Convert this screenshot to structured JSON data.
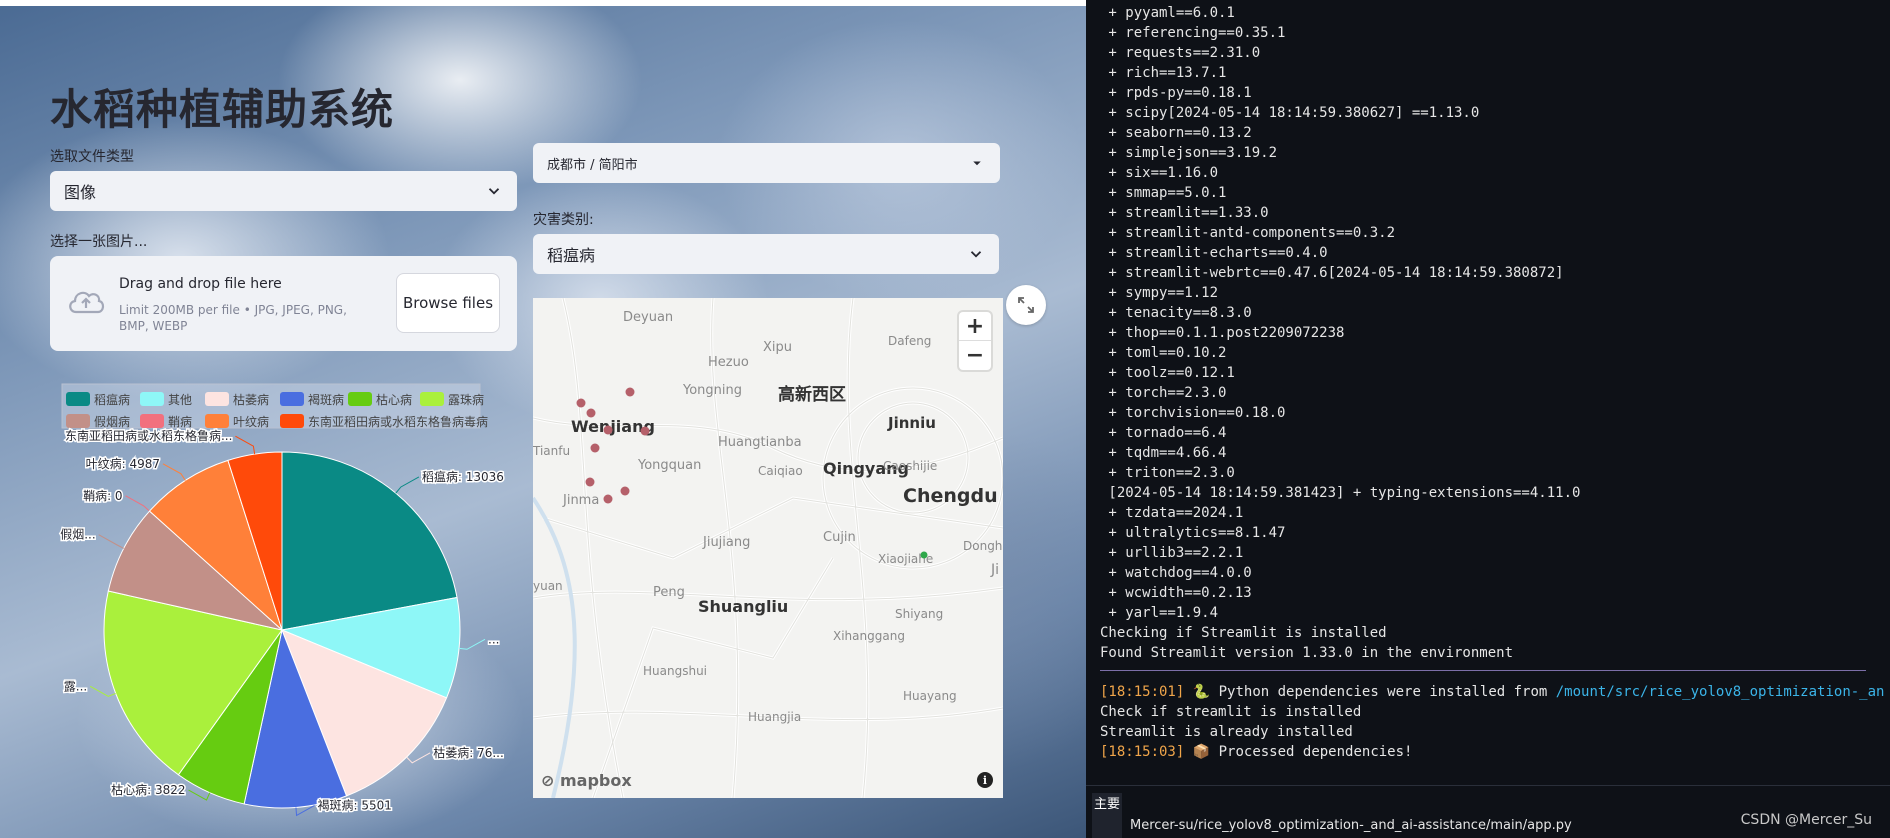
{
  "app": {
    "title": "水稻种植辅助系统",
    "file_type": {
      "label": "选取文件类型",
      "value": "图像"
    },
    "image_picker": {
      "label": "选择一张图片..."
    },
    "uploader": {
      "drag_text": "Drag and drop file here",
      "limit_text": "Limit 200MB per file • JPG, JPEG, PNG, BMP, WEBP",
      "browse_label": "Browse files"
    },
    "location": {
      "value": "成都市 / 简阳市"
    },
    "disaster": {
      "label": "灾害类别:",
      "value": "稻瘟病"
    }
  },
  "chart_data": {
    "type": "pie",
    "title": "",
    "legend": [
      "稻瘟病",
      "其他",
      "枯萎病",
      "褐斑病",
      "枯心病",
      "露珠病",
      "假烟病",
      "鞘病",
      "叶纹病",
      "东南亚稻田病或水稻东格鲁病毒病"
    ],
    "legend_placement": "top-left",
    "slices": [
      {
        "name": "稻瘟病",
        "label": "稻瘟病: 13036",
        "value": 13036,
        "color": "#0a8a85"
      },
      {
        "name": "其他",
        "label": "...",
        "value": 5400,
        "color": "#8ef7f7"
      },
      {
        "name": "枯萎病",
        "label": "枯萎病: 76...",
        "value": 7600,
        "color": "#fde4e1"
      },
      {
        "name": "褐斑病",
        "label": "褐斑病: 5501",
        "value": 5501,
        "color": "#4a6ee0"
      },
      {
        "name": "枯心病",
        "label": "枯心病: 3822",
        "value": 3822,
        "color": "#66cc11"
      },
      {
        "name": "露珠病",
        "label": "露...",
        "value": 11000,
        "color": "#aaf03c"
      },
      {
        "name": "假烟病",
        "label": "假烟...",
        "value": 4800,
        "color": "#c29088"
      },
      {
        "name": "鞘病",
        "label": "鞘病: 0",
        "value": 0,
        "color": "#f2707e"
      },
      {
        "name": "叶纹病",
        "label": "叶纹病: 4987",
        "value": 4987,
        "color": "#ff8039"
      },
      {
        "name": "东南亚稻田病或水稻东格鲁病毒病",
        "label": "东南亚稻田病或水稻东格鲁病...",
        "value": 2900,
        "color": "#ff4a0a"
      }
    ]
  },
  "map": {
    "places": [
      {
        "name": "Deyuan",
        "size": 13
      },
      {
        "name": "Xipu",
        "size": 13
      },
      {
        "name": "Dafeng",
        "size": 12
      },
      {
        "name": "Hezuo",
        "size": 13
      },
      {
        "name": "Yongning",
        "size": 13
      },
      {
        "name": "高新西区",
        "size": 17
      },
      {
        "name": "Jinniu",
        "size": 15
      },
      {
        "name": "Wenjiang",
        "size": 16
      },
      {
        "name": "Tianfu",
        "size": 12
      },
      {
        "name": "Huangtianba",
        "size": 13
      },
      {
        "name": "Qingyang",
        "size": 16
      },
      {
        "name": "Yongquan",
        "size": 13
      },
      {
        "name": "Caiqiao",
        "size": 12
      },
      {
        "name": "Caoshijie",
        "size": 12
      },
      {
        "name": "Chengdu",
        "size": 19
      },
      {
        "name": "Jinma",
        "size": 13
      },
      {
        "name": "Jiujiang",
        "size": 13
      },
      {
        "name": "Cujin",
        "size": 13
      },
      {
        "name": "Xiaojiahe",
        "size": 12
      },
      {
        "name": "Dongh",
        "size": 12
      },
      {
        "name": "Ji",
        "size": 14
      },
      {
        "name": "yuan",
        "size": 12
      },
      {
        "name": "Peng",
        "size": 13
      },
      {
        "name": "Shuangliu",
        "size": 16
      },
      {
        "name": "Shiyang",
        "size": 12
      },
      {
        "name": "Xihanggang",
        "size": 12
      },
      {
        "name": "Huangshui",
        "size": 12
      },
      {
        "name": "Huayang",
        "size": 12
      },
      {
        "name": "Huangjia",
        "size": 12
      }
    ],
    "attribution": "mapbox",
    "zoom_in": "+",
    "zoom_out": "−",
    "info": "i"
  },
  "terminal": {
    "lines": [
      " + pyyaml==6.0.1",
      " + referencing==0.35.1",
      " + requests==2.31.0",
      " + rich==13.7.1",
      " + rpds-py==0.18.1",
      " + scipy[2024-05-14 18:14:59.380627] ==1.13.0",
      " + seaborn==0.13.2",
      " + simplejson==3.19.2",
      " + six==1.16.0",
      " + smmap==5.0.1",
      " + streamlit==1.33.0",
      " + streamlit-antd-components==0.3.2",
      " + streamlit-echarts==0.4.0",
      " + streamlit-webrtc==0.47.6[2024-05-14 18:14:59.380872]",
      " + sympy==1.12",
      " + tenacity==8.3.0",
      " + thop==0.1.1.post2209072238",
      " + toml==0.10.2",
      " + toolz==0.12.1",
      " + torch==2.3.0",
      " + torchvision==0.18.0",
      " + tornado==6.4",
      " + tqdm==4.66.4",
      " + triton==2.3.0",
      " [2024-05-14 18:14:59.381423] + typing-extensions==4.11.0",
      " + tzdata==2024.1",
      " + ultralytics==8.1.47",
      " + urllib3==2.2.1",
      " + watchdog==4.0.0",
      " + wcwidth==0.2.13",
      " + yarl==1.9.4",
      "Checking if Streamlit is installed",
      "Found Streamlit version 1.33.0 in the environment"
    ],
    "deps_installed": {
      "ts": "[18:15:01]",
      "icon": "🐍",
      "text": " Python dependencies were installed from ",
      "path": "/mount/src/rice_yolov8_optimization-_an"
    },
    "check_line": "Check if streamlit is installed",
    "already_line": "Streamlit is already installed",
    "processed": {
      "ts": "[18:15:03]",
      "icon": "📦",
      "text": " Processed dependencies!"
    },
    "footer_tag": "主要",
    "footer_path": "Mercer-su/rice_yolov8_optimization-_and_ai-assistance/main/app.py",
    "watermark": "CSDN @Mercer_Su"
  },
  "colors": {
    "terminal_bg": "#0e1117",
    "timestamp": "#f0a54a",
    "path": "#3bb4e8",
    "input_bg": "#f0f2f6",
    "text": "#262730"
  }
}
